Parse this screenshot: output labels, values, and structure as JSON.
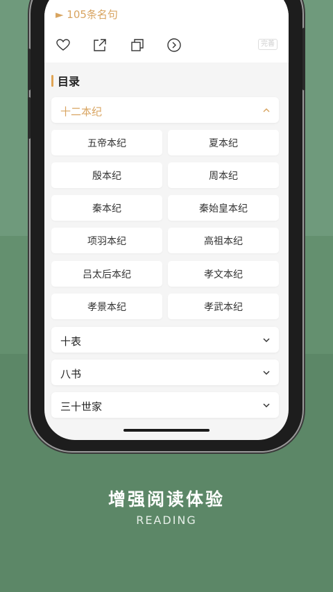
{
  "header": {
    "quote_link": "► 105条名句",
    "badge": "完善",
    "icons": [
      "heart-icon",
      "share-icon",
      "copy-icon",
      "next-icon"
    ]
  },
  "toc": {
    "title": "目录",
    "categories": [
      {
        "label": "十二本纪",
        "expanded": true,
        "items": [
          "五帝本纪",
          "夏本纪",
          "殷本纪",
          "周本纪",
          "秦本纪",
          "秦始皇本纪",
          "项羽本纪",
          "高祖本纪",
          "吕太后本纪",
          "孝文本纪",
          "孝景本纪",
          "孝武本纪"
        ]
      },
      {
        "label": "十表",
        "expanded": false
      },
      {
        "label": "八书",
        "expanded": false
      },
      {
        "label": "三十世家",
        "expanded": false
      }
    ]
  },
  "promo": {
    "title": "增强阅读体验",
    "subtitle": "READING"
  },
  "colors": {
    "accent": "#d8a460",
    "background_green": "#5a8566"
  }
}
